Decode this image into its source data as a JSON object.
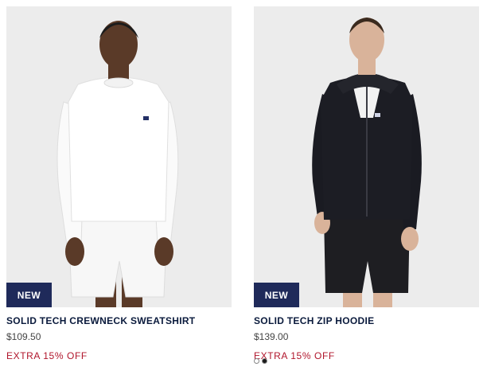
{
  "products": [
    {
      "name": "SOLID TECH CREWNECK SWEATSHIRT",
      "price": "$109.50",
      "promo": "EXTRA 15% OFF",
      "badge": "NEW",
      "image_icon": "model-white-crewneck-image"
    },
    {
      "name": "SOLID TECH ZIP HOODIE",
      "price": "$139.00",
      "promo": "EXTRA 15% OFF",
      "badge": "NEW",
      "image_icon": "model-black-zip-hoodie-image",
      "swatches": [
        "#ffffff",
        "#1a1a1a"
      ]
    }
  ],
  "colors": {
    "badge_bg": "#1f2a5a",
    "title": "#0a1a3c",
    "promo": "#b0152b",
    "image_bg": "#ececec"
  }
}
